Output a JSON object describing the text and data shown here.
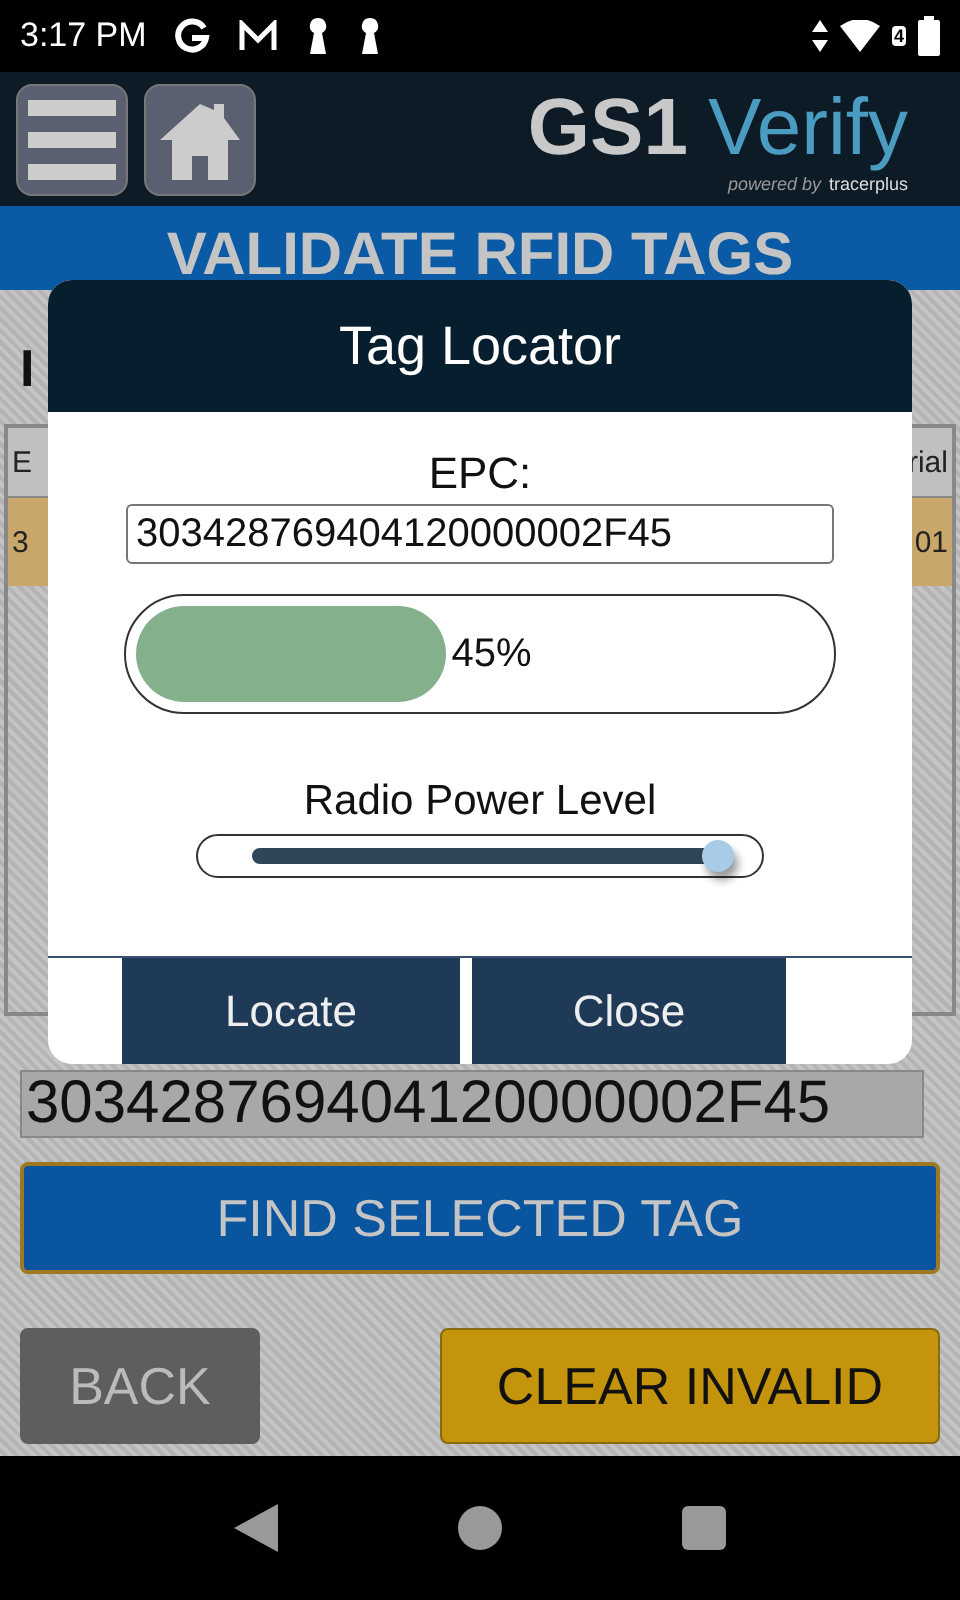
{
  "status_bar": {
    "time": "3:17 PM",
    "wifi_badge": "4"
  },
  "header": {
    "logo_main": "GS1",
    "logo_accent": "Verify",
    "powered_by": "powered by",
    "powered_brand": "tracerplus"
  },
  "title_bar": {
    "title": "VALIDATE RFID TAGS"
  },
  "section_heading": "I",
  "table": {
    "columns": [
      "E",
      "rial"
    ],
    "rows": [
      {
        "cells": [
          "3",
          "01"
        ],
        "selected": true
      }
    ]
  },
  "epc_field": {
    "value": "303428769404120000002F45"
  },
  "find_button": "FIND SELECTED TAG",
  "back_button": "BACK",
  "clear_button": "CLEAR INVALID",
  "dialog": {
    "title": "Tag Locator",
    "epc_label": "EPC:",
    "epc_value": "303428769404120000002F45",
    "signal": {
      "level": 0.45,
      "reading": "45%"
    },
    "power": {
      "label": "Radio Power Level",
      "level": 1.0
    },
    "buttons": [
      "Locate",
      "Close"
    ]
  }
}
